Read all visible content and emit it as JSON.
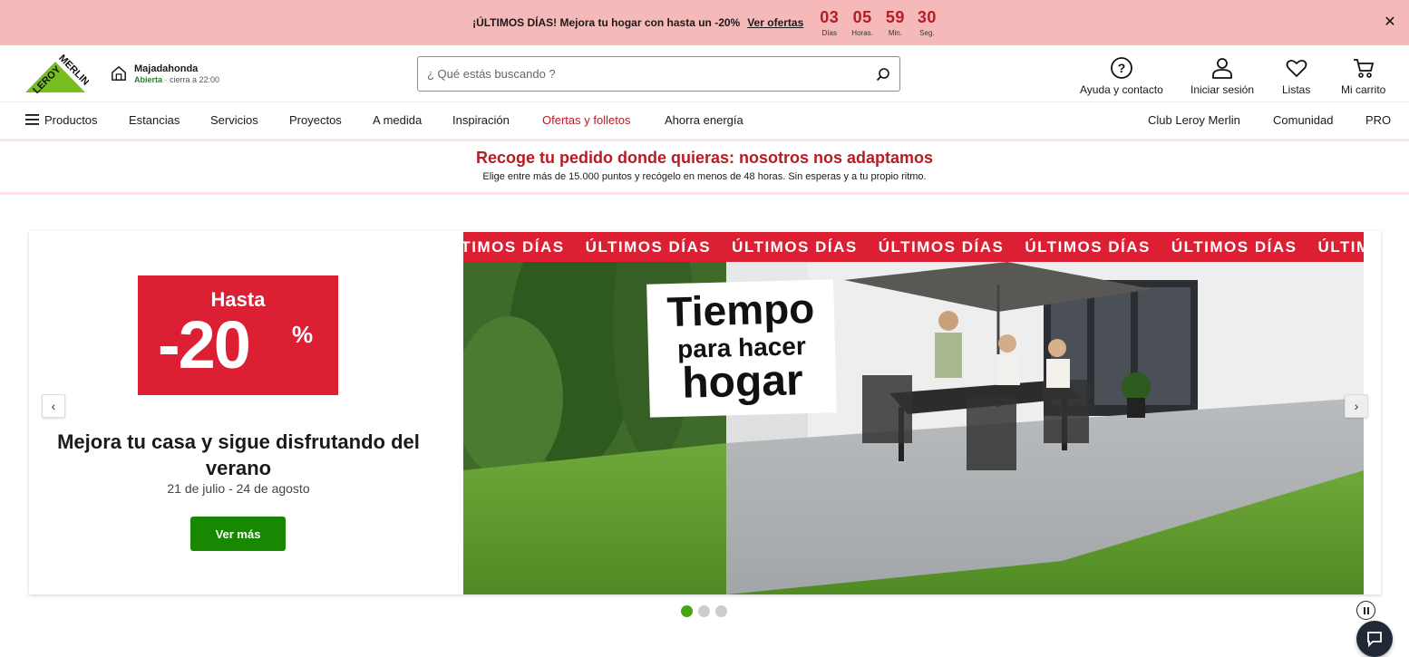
{
  "promo": {
    "text": "¡ÚLTIMOS DÍAS! Mejora tu hogar con hasta un -20%",
    "link": "Ver ofertas",
    "countdown": [
      {
        "value": "03",
        "label": "Días"
      },
      {
        "value": "05",
        "label": "Horas."
      },
      {
        "value": "59",
        "label": "Min."
      },
      {
        "value": "30",
        "label": "Seg."
      }
    ],
    "close": "✕"
  },
  "header": {
    "logo_text": "LEROY MERLIN",
    "store": {
      "name": "Majadahonda",
      "open": "Abierta",
      "hours": " · cierra a 22:00"
    },
    "search": {
      "placeholder": "¿ Qué estás buscando ?"
    },
    "actions": [
      {
        "label": "Ayuda y contacto",
        "icon": "help-icon"
      },
      {
        "label": "Iniciar sesión",
        "icon": "user-icon"
      },
      {
        "label": "Listas",
        "icon": "heart-icon"
      },
      {
        "label": "Mi carrito",
        "icon": "cart-icon"
      }
    ]
  },
  "nav": {
    "left": [
      "Productos",
      "Estancias",
      "Servicios",
      "Proyectos",
      "A medida",
      "Inspiración",
      "Ofertas y folletos",
      "Ahorra energía"
    ],
    "right": [
      "Club Leroy Merlin",
      "Comunidad",
      "PRO"
    ]
  },
  "pickup": {
    "title": "Recoge tu pedido donde quieras: nosotros nos adaptamos",
    "subtitle": "Elige entre más de 15.000 puntos y recógelo en menos de 48 horas. Sin esperas y a tu propio ritmo."
  },
  "hero": {
    "discount_hasta": "Hasta",
    "discount_value": "-20",
    "discount_pct": "%",
    "title": "Mejora tu casa y sigue disfrutando del verano",
    "dates": "21 de julio - 24 de agosto",
    "cta": "Ver más",
    "ticker": "ÚLTIMOS DÍAS",
    "slogan": {
      "line1": "Tiempo",
      "line2": "para hacer",
      "line3": "hogar"
    },
    "prev": "‹",
    "next": "›"
  },
  "colors": {
    "promo_bg": "#f5b9b9",
    "brand_red": "#dc1f32",
    "brand_green": "#188803",
    "logo_green": "#78be20"
  }
}
